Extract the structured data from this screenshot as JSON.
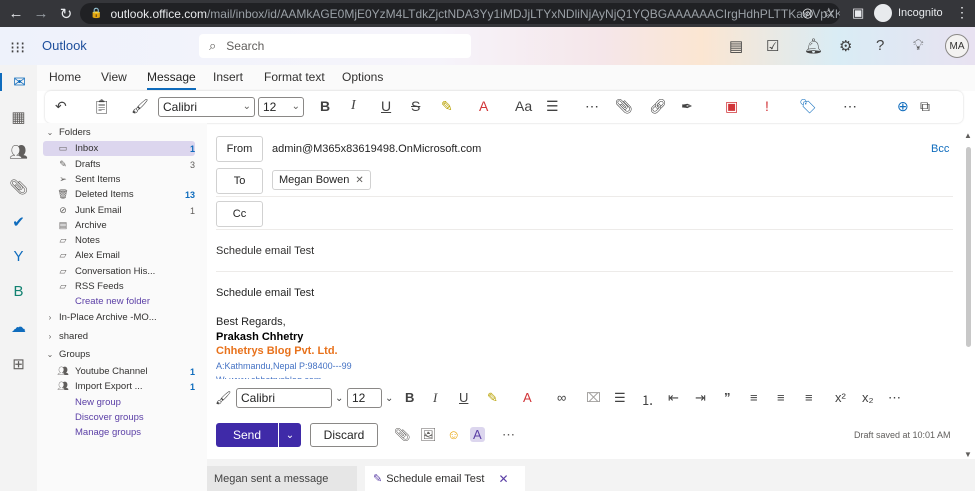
{
  "browser": {
    "url_host": "outlook.office.com",
    "url_path": "/mail/inbox/id/AAMkAGE0MjE0YzM4LTdkZjctNDA3Yy1iMDJjLTYxNDliNjAyNjQ1YQBGAAAAAACIrgHdhPLTTKavIVpXKL4JBwB9...",
    "profile_label": "Incognito"
  },
  "header": {
    "app_name": "Outlook",
    "search_placeholder": "Search",
    "avatar_initials": "MA"
  },
  "ribbon_tabs": [
    {
      "label": "Home"
    },
    {
      "label": "View"
    },
    {
      "label": "Message"
    },
    {
      "label": "Insert"
    },
    {
      "label": "Format text"
    },
    {
      "label": "Options"
    }
  ],
  "ribbon": {
    "font_name": "Calibri",
    "font_size": "12"
  },
  "folders": {
    "section_label": "Folders",
    "items": [
      {
        "label": "Inbox",
        "count": "1"
      },
      {
        "label": "Drafts",
        "count": "3"
      },
      {
        "label": "Sent Items",
        "count": ""
      },
      {
        "label": "Deleted Items",
        "count": "13"
      },
      {
        "label": "Junk Email",
        "count": "1"
      },
      {
        "label": "Archive",
        "count": ""
      },
      {
        "label": "Notes",
        "count": ""
      },
      {
        "label": "Alex Email",
        "count": ""
      },
      {
        "label": "Conversation His...",
        "count": ""
      },
      {
        "label": "RSS Feeds",
        "count": ""
      }
    ],
    "create_new_folder": "Create new folder",
    "in_place_archive": "In-Place Archive -MO...",
    "shared": "shared",
    "groups_label": "Groups",
    "groups": [
      {
        "label": "Youtube Channel",
        "count": "1"
      },
      {
        "label": "Import Export ...",
        "count": "1"
      }
    ],
    "new_group": "New group",
    "discover_groups": "Discover groups",
    "manage_groups": "Manage groups"
  },
  "compose": {
    "from_label": "From",
    "from_value": "admin@M365x83619498.OnMicrosoft.com",
    "bcc_label": "Bcc",
    "to_label": "To",
    "to_recipient": "Megan Bowen",
    "cc_label": "Cc",
    "subject": "Schedule email Test",
    "body_line1": "Schedule email Test",
    "body_regards": "Best Regards,",
    "sig_name": "Prakash Chhetry",
    "sig_company": "Chhetrys Blog Pvt. Ltd.",
    "sig_address": "A:Kathmandu,Nepal P:98400---99",
    "sig_cut": "W: www.chhetrysblog.com"
  },
  "format_bar": {
    "font_name": "Calibri",
    "font_size": "12"
  },
  "send_bar": {
    "send_label": "Send",
    "discard_label": "Discard",
    "draft_status": "Draft saved at 10:01 AM"
  },
  "bottom_tabs": {
    "tab1": "Megan sent a message",
    "tab2": "Schedule email Test"
  }
}
